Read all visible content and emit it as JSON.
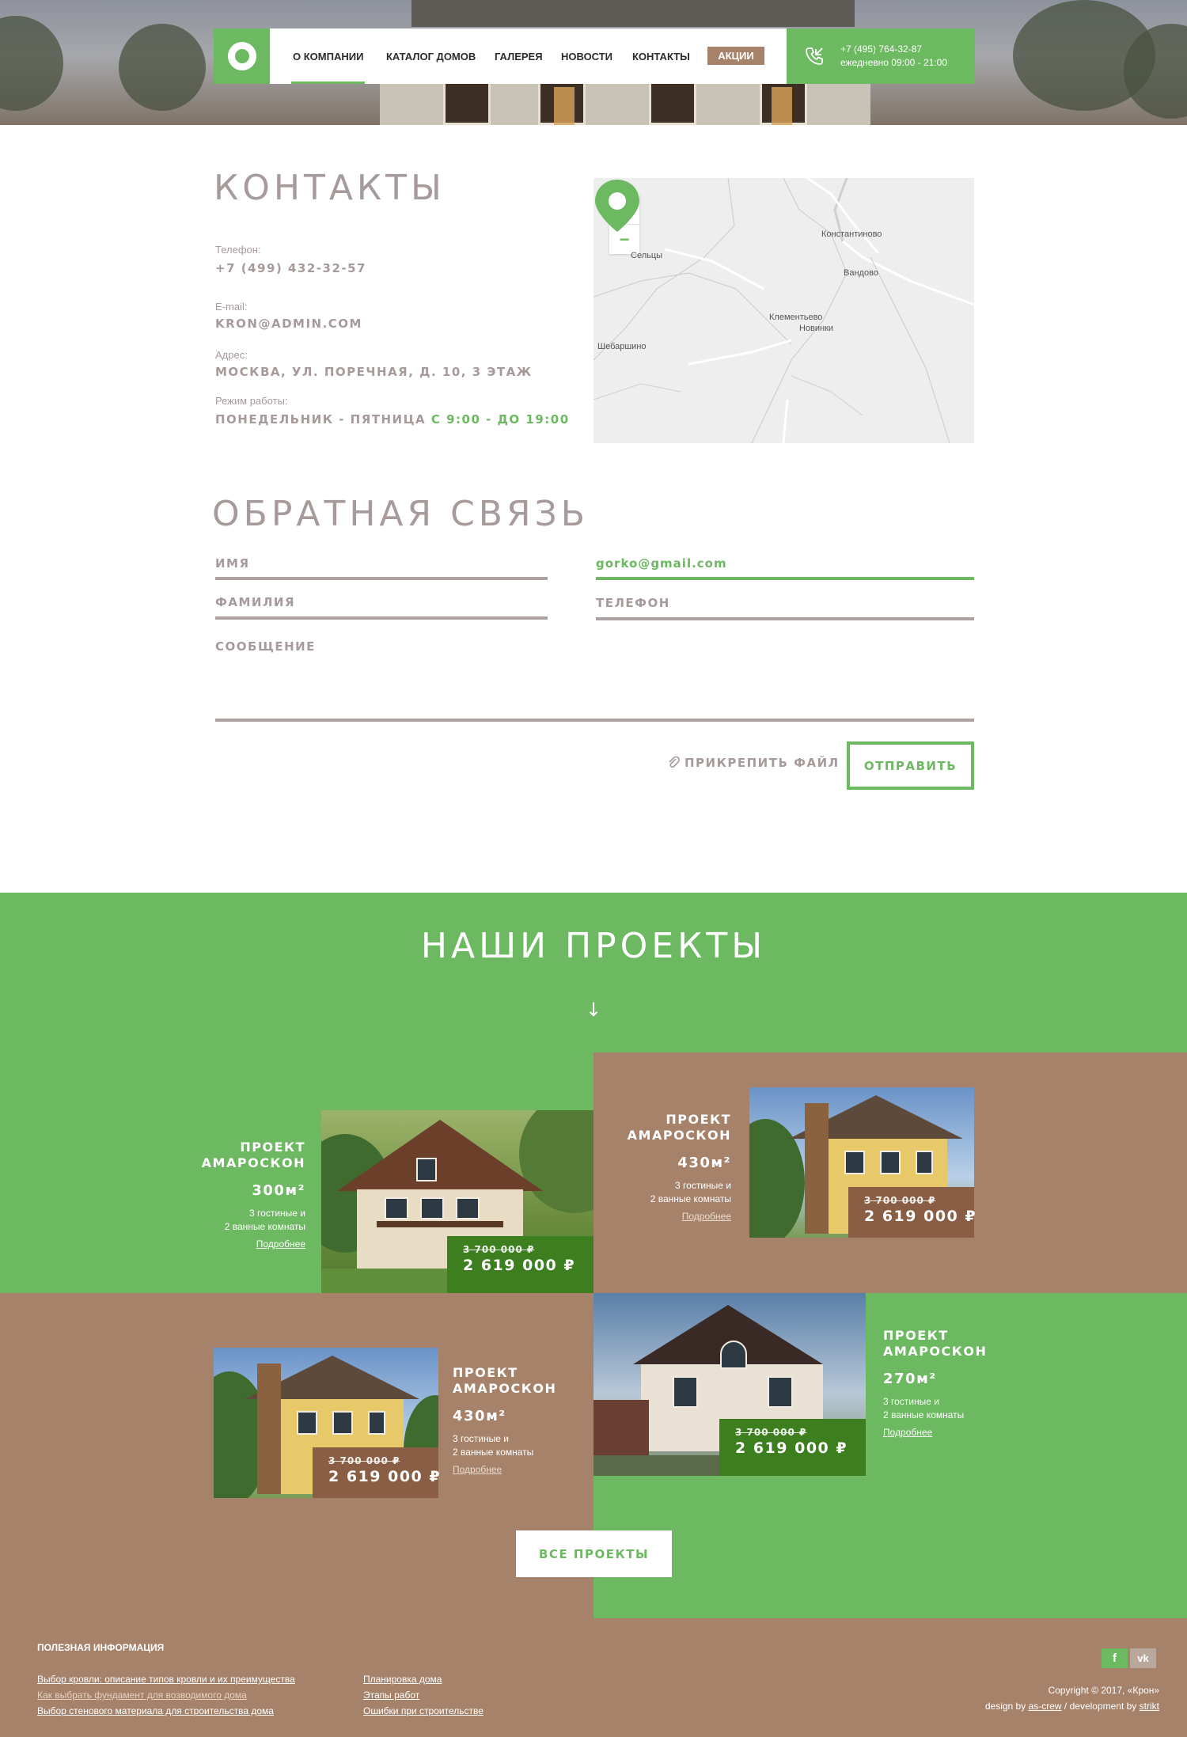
{
  "nav": {
    "items": [
      "О КОМПАНИИ",
      "КАТАЛОГ ДОМОВ",
      "ГАЛЕРЕЯ",
      "НОВОСТИ",
      "КОНТАКТЫ"
    ],
    "sale_label": "АКЦИИ",
    "phone": "+7 (495) 764-32-87",
    "hours": "ежедневно 09:00 - 21:00",
    "active_item": "О КОМПАНИИ"
  },
  "contacts": {
    "title": "КОНТАКТЫ",
    "phone_label": "Телефон:",
    "phone": "+7 (499) 432-32-57",
    "email_label": "E-mail:",
    "email": "KRON@ADMIN.COM",
    "address_label": "Адрес:",
    "address": "МОСКВА, УЛ. ПОРЕЧНАЯ, Д. 10, 3 ЭТАЖ",
    "hours_label": "Режим работы:",
    "hours_days": "ПОНЕДЕЛЬНИК - ПЯТНИЦА",
    "hours_time": "С 9:00 - ДО 19:00"
  },
  "map": {
    "zoom_in": "+",
    "zoom_out": "−",
    "places": [
      "Константиново",
      "Сельцы",
      "Вандово",
      "Клементьево",
      "Новинки",
      "Шебаршино"
    ]
  },
  "feedback": {
    "title": "ОБРАТНАЯ СВЯЗЬ",
    "name_label": "ИМЯ",
    "email_value": "gorko@gmail.com",
    "surname_label": "ФАМИЛИЯ",
    "phone_label": "ТЕЛЕФОН",
    "message_label": "СООБЩЕНИЕ",
    "attach_label": "ПРИКРЕПИТЬ ФАЙЛ",
    "send_label": "ОТПРАВИТЬ"
  },
  "projects": {
    "title": "НАШИ ПРОЕКТЫ",
    "arrow": "↓",
    "all_label": "ВСЕ ПРОЕКТЫ",
    "items": [
      {
        "title_1": "ПРОЕКТ",
        "title_2": "АМАРОСКОН",
        "area": "300м²",
        "rooms_1": "3 гостиные и",
        "rooms_2": "2 ванные комнаты",
        "more": "Подробнее",
        "old_price": "3 700 000 ₽",
        "price": "2 619 000 ₽"
      },
      {
        "title_1": "ПРОЕКТ",
        "title_2": "АМАРОСКОН",
        "area": "430м²",
        "rooms_1": "3 гостиные и",
        "rooms_2": "2 ванные комнаты",
        "more": "Подробнее",
        "old_price": "3 700 000 ₽",
        "price": "2 619 000 ₽"
      },
      {
        "title_1": "ПРОЕКТ",
        "title_2": "АМАРОСКОН",
        "area": "430м²",
        "rooms_1": "3 гостиные и",
        "rooms_2": "2 ванные комнаты",
        "more": "Подробнее",
        "old_price": "3 700 000 ₽",
        "price": "2 619 000 ₽"
      },
      {
        "title_1": "ПРОЕКТ",
        "title_2": "АМАРОСКОН",
        "area": "270м²",
        "rooms_1": "3 гостиные и",
        "rooms_2": "2 ванные комнаты",
        "more": "Подробнее",
        "old_price": "3 700 000 ₽",
        "price": "2 619 000 ₽"
      }
    ]
  },
  "footer": {
    "title": "ПОЛЕЗНАЯ ИНФОРМАЦИЯ",
    "links_left": [
      "Выбор кровли: описание типов кровли и их преимущества",
      "Как выбрать фундамент для возводимого дома",
      "Выбор стенового материала для строительства дома"
    ],
    "links_right": [
      "Планировка дома",
      "Этапы работ",
      "Ошибки при строительстве"
    ],
    "social": [
      "f",
      "vk"
    ],
    "copyright": "Copyright ©  2017, «Крон»",
    "design_prefix": "design by",
    "design_by": "as-crew",
    "dev_prefix": "/ development by",
    "dev_by": "strikt"
  },
  "colors": {
    "green": "#6cb961",
    "brown": "#a6826a",
    "text_gray": "#a69a9a",
    "dark_green": "#3d7f1f"
  }
}
